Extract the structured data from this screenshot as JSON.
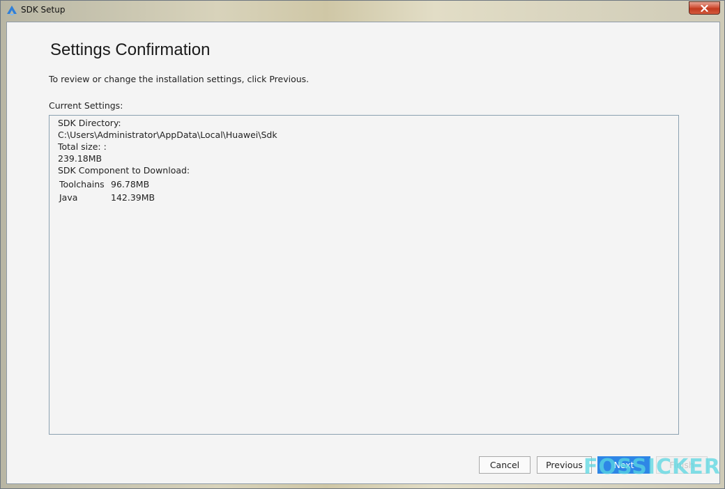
{
  "window": {
    "title": "SDK Setup",
    "close_icon": "close-icon",
    "app_icon": "huawei-devecostudio-icon"
  },
  "page": {
    "title": "Settings Confirmation",
    "instruction": "To review or change the installation settings, click Previous.",
    "settings_label": "Current Settings:"
  },
  "settings": {
    "sdk_directory_label": "SDK Directory:",
    "sdk_directory_value": "C:\\Users\\Administrator\\AppData\\Local\\Huawei\\Sdk",
    "total_size_label": "Total size: :",
    "total_size_value": "239.18MB",
    "components_label": "SDK Component to Download:",
    "components": [
      {
        "name": "Toolchains",
        "size": "96.78MB"
      },
      {
        "name": "Java",
        "size": "142.39MB"
      }
    ]
  },
  "buttons": {
    "cancel": "Cancel",
    "previous": "Previous",
    "next": "Next",
    "finish": "Finish"
  },
  "watermark": "FOSSICKER",
  "colors": {
    "accent": "#2e86e6",
    "close_button": "#c23a1f"
  }
}
